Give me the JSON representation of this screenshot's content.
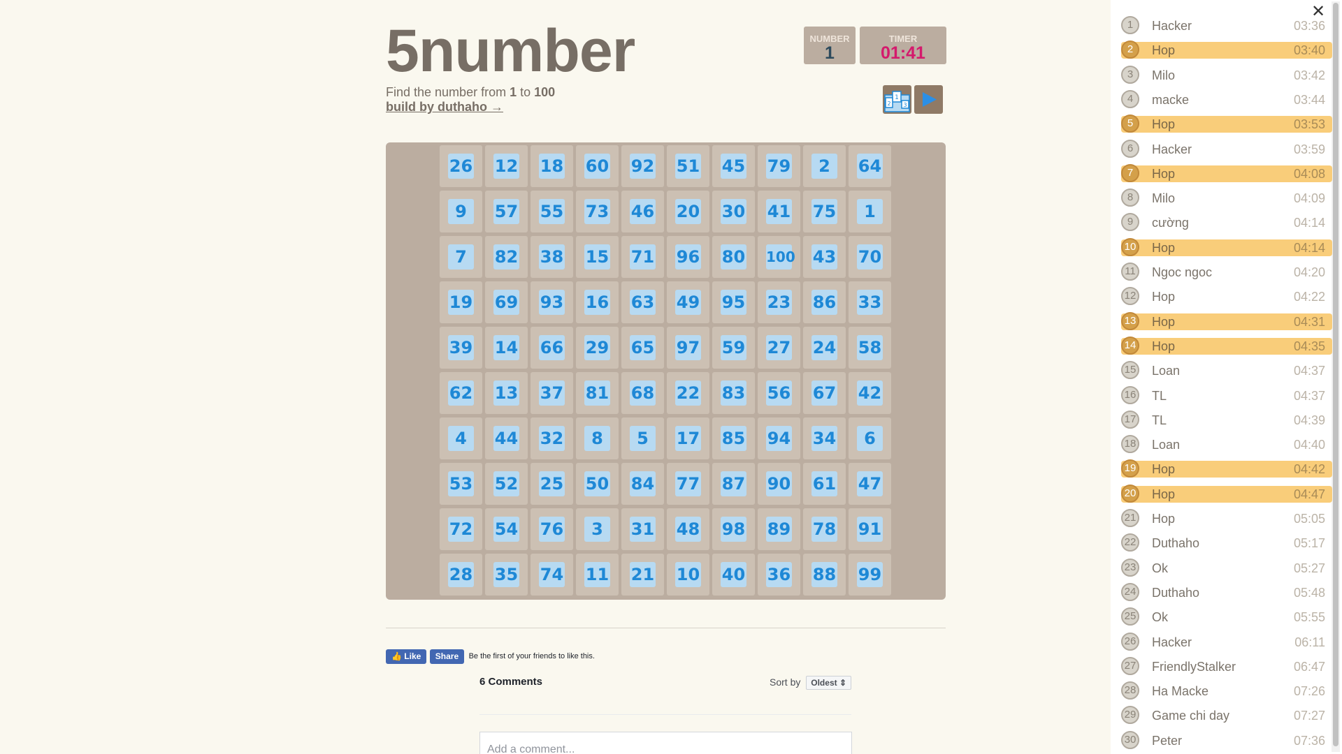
{
  "game": {
    "title": "5number",
    "subtitle_prefix": "Find the number from",
    "range_from": "1",
    "range_to_word": "to",
    "range_to": "100",
    "credit": "build by duthaho →",
    "number_label": "NUMBER",
    "number_value": "1",
    "timer_label": "TIMER",
    "timer_value": "01:41"
  },
  "board": [
    [
      "26",
      "12",
      "18",
      "60",
      "92",
      "51",
      "45",
      "79",
      "2",
      "64"
    ],
    [
      "9",
      "57",
      "55",
      "73",
      "46",
      "20",
      "30",
      "41",
      "75",
      "1"
    ],
    [
      "7",
      "82",
      "38",
      "15",
      "71",
      "96",
      "80",
      "100",
      "43",
      "70"
    ],
    [
      "19",
      "69",
      "93",
      "16",
      "63",
      "49",
      "95",
      "23",
      "86",
      "33"
    ],
    [
      "39",
      "14",
      "66",
      "29",
      "65",
      "97",
      "59",
      "27",
      "24",
      "58"
    ],
    [
      "62",
      "13",
      "37",
      "81",
      "68",
      "22",
      "83",
      "56",
      "67",
      "42"
    ],
    [
      "4",
      "44",
      "32",
      "8",
      "5",
      "17",
      "85",
      "94",
      "34",
      "6"
    ],
    [
      "53",
      "52",
      "25",
      "50",
      "84",
      "77",
      "87",
      "90",
      "61",
      "47"
    ],
    [
      "72",
      "54",
      "76",
      "3",
      "31",
      "48",
      "98",
      "89",
      "78",
      "91"
    ],
    [
      "28",
      "35",
      "74",
      "11",
      "21",
      "10",
      "40",
      "36",
      "88",
      "99"
    ]
  ],
  "facebook": {
    "like": "Like",
    "share": "Share",
    "text": "Be the first of your friends to like this."
  },
  "comments": {
    "count_label": "6 Comments",
    "sort_label": "Sort by",
    "sort_value": "Oldest ⇕",
    "placeholder": "Add a comment..."
  },
  "leaderboard": {
    "close": "✕",
    "entries": [
      {
        "rank": "1",
        "name": "Hacker",
        "time": "03:36",
        "highlight": false
      },
      {
        "rank": "2",
        "name": "Hop",
        "time": "03:40",
        "highlight": true
      },
      {
        "rank": "3",
        "name": "Milo",
        "time": "03:42",
        "highlight": false
      },
      {
        "rank": "4",
        "name": "macke",
        "time": "03:44",
        "highlight": false
      },
      {
        "rank": "5",
        "name": "Hop",
        "time": "03:53",
        "highlight": true
      },
      {
        "rank": "6",
        "name": "Hacker",
        "time": "03:59",
        "highlight": false
      },
      {
        "rank": "7",
        "name": "Hop",
        "time": "04:08",
        "highlight": true
      },
      {
        "rank": "8",
        "name": "Milo",
        "time": "04:09",
        "highlight": false
      },
      {
        "rank": "9",
        "name": "cường",
        "time": "04:14",
        "highlight": false
      },
      {
        "rank": "10",
        "name": "Hop",
        "time": "04:14",
        "highlight": true
      },
      {
        "rank": "11",
        "name": "Ngoc ngoc",
        "time": "04:20",
        "highlight": false
      },
      {
        "rank": "12",
        "name": "Hop",
        "time": "04:22",
        "highlight": false
      },
      {
        "rank": "13",
        "name": "Hop",
        "time": "04:31",
        "highlight": true
      },
      {
        "rank": "14",
        "name": "Hop",
        "time": "04:35",
        "highlight": true
      },
      {
        "rank": "15",
        "name": "Loan",
        "time": "04:37",
        "highlight": false
      },
      {
        "rank": "16",
        "name": "TL",
        "time": "04:37",
        "highlight": false
      },
      {
        "rank": "17",
        "name": "TL",
        "time": "04:39",
        "highlight": false
      },
      {
        "rank": "18",
        "name": "Loan",
        "time": "04:40",
        "highlight": false
      },
      {
        "rank": "19",
        "name": "Hop",
        "time": "04:42",
        "highlight": true
      },
      {
        "rank": "20",
        "name": "Hop",
        "time": "04:47",
        "highlight": true
      },
      {
        "rank": "21",
        "name": "Hop",
        "time": "05:05",
        "highlight": false
      },
      {
        "rank": "22",
        "name": "Duthaho",
        "time": "05:17",
        "highlight": false
      },
      {
        "rank": "23",
        "name": "Ok",
        "time": "05:27",
        "highlight": false
      },
      {
        "rank": "24",
        "name": "Duthaho",
        "time": "05:48",
        "highlight": false
      },
      {
        "rank": "25",
        "name": "Ok",
        "time": "05:55",
        "highlight": false
      },
      {
        "rank": "26",
        "name": "Hacker",
        "time": "06:11",
        "highlight": false
      },
      {
        "rank": "27",
        "name": "FriendlyStalker",
        "time": "06:47",
        "highlight": false
      },
      {
        "rank": "28",
        "name": "Ha Macke",
        "time": "07:26",
        "highlight": false
      },
      {
        "rank": "29",
        "name": "Game chi day",
        "time": "07:27",
        "highlight": false
      },
      {
        "rank": "30",
        "name": "Peter",
        "time": "07:36",
        "highlight": false
      }
    ]
  }
}
